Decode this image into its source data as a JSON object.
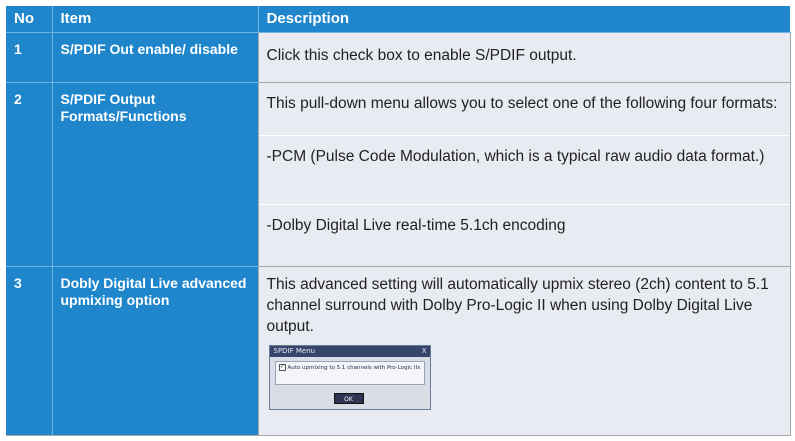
{
  "header": {
    "no": "No",
    "item": "Item",
    "description": "Description"
  },
  "rows": [
    {
      "no": "1",
      "item": "S/PDIF Out enable/ disable",
      "descriptions": [
        "Click this check box to enable S/PDIF output."
      ]
    },
    {
      "no": "2",
      "item": "S/PDIF Output Formats/Functions",
      "descriptions": [
        "This pull-down menu allows you to select one of the following four formats:",
        "-PCM (Pulse Code Modulation, which is a typical raw audio data format.)",
        "-Dolby Digital Live real-time 5.1ch encoding"
      ]
    },
    {
      "no": "3",
      "item": "Dobly Digital Live advanced upmixing option",
      "descriptions": [
        "This advanced setting will automatically upmix stereo (2ch) content to 5.1 channel surround with Dolby Pro-Logic II when using Dolby Digital Live output."
      ]
    }
  ],
  "dialog": {
    "title": "SPDIF Menu",
    "close": "X",
    "checkbox_mark": "✓",
    "checkbox_label": "Auto upmixing to 5.1 channels with Pro-Logic IIx",
    "ok_label": "OK"
  },
  "colors": {
    "header_blue": "#1f86cc",
    "desc_background": "#e8ebf1"
  }
}
